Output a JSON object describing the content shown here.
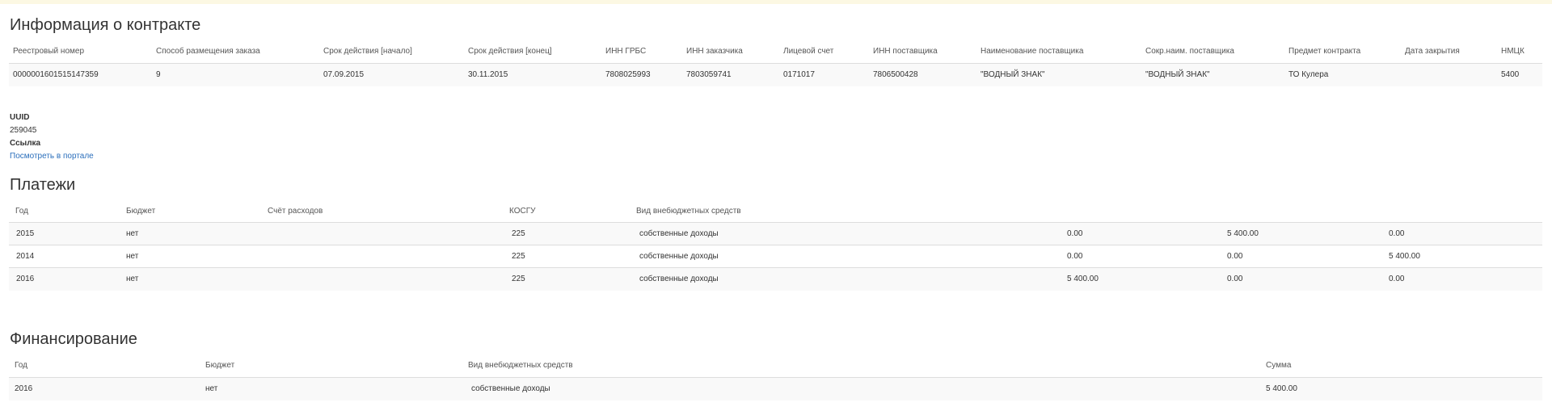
{
  "contract": {
    "title": "Информация о контракте",
    "headers": [
      "Реестровый номер",
      "Способ размещения заказа",
      "Срок действия [начало]",
      "Срок действия [конец]",
      "ИНН ГРБС",
      "ИНН заказчика",
      "Лицевой счет",
      "ИНН поставщика",
      "Наименование поставщика",
      "Сокр.наим. поставщика",
      "Предмет контракта",
      "Дата закрытия",
      "НМЦК"
    ],
    "row": [
      "0000001601515147359",
      "9",
      "07.09.2015",
      "30.11.2015",
      "7808025993",
      "7803059741",
      "0171017",
      "7806500428",
      "\"ВОДНЫЙ ЗНАК\"",
      "\"ВОДНЫЙ ЗНАК\"",
      "ТО Кулера",
      "",
      "5400"
    ]
  },
  "meta": {
    "uuid_label": "UUID",
    "uuid_value": "259045",
    "link_label": "Ссылка",
    "link_text": "Посмотреть в портале"
  },
  "payments": {
    "title": "Платежи",
    "headers": [
      "Год",
      "Бюджет",
      "Счёт расходов",
      "КОСГУ",
      "Вид внебюджетных средств",
      "",
      "",
      ""
    ],
    "rows": [
      [
        "2015",
        "нет",
        "",
        "225",
        "собственные доходы",
        "0.00",
        "5 400.00",
        "0.00"
      ],
      [
        "2014",
        "нет",
        "",
        "225",
        "собственные доходы",
        "0.00",
        "0.00",
        "5 400.00"
      ],
      [
        "2016",
        "нет",
        "",
        "225",
        "собственные доходы",
        "5 400.00",
        "0.00",
        "0.00"
      ]
    ]
  },
  "financing": {
    "title": "Финансирование",
    "headers": [
      "Год",
      "Бюджет",
      "Вид внебюджетных средств",
      "Сумма"
    ],
    "rows": [
      [
        "2016",
        "нет",
        "собственные доходы",
        "5 400.00"
      ]
    ]
  }
}
